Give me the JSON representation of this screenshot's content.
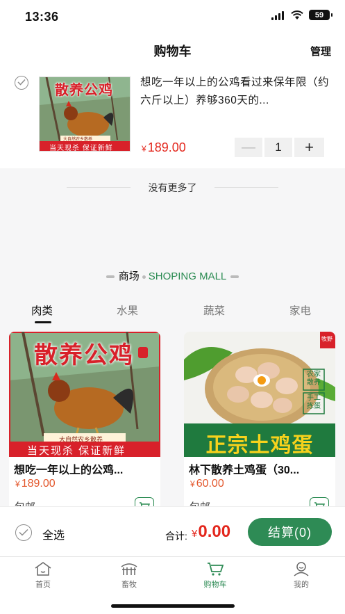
{
  "status_bar": {
    "time": "13:36",
    "battery": "59"
  },
  "nav": {
    "title": "购物车",
    "manage": "管理"
  },
  "cart": {
    "item": {
      "title": "想吃一年以上的公鸡看过来保年限（约六斤以上）养够360天的...",
      "currency": "¥",
      "price": "189.00",
      "quantity": "1",
      "minus": "—",
      "plus": "+",
      "image_banner": "散养公鸡",
      "image_sub": "大自然农乡散养",
      "image_footer": "当天现杀 保证新鲜"
    },
    "no_more": "没有更多了"
  },
  "mall": {
    "title_cn": "商场",
    "title_en": "SHOPING MALL",
    "tabs": [
      "肉类",
      "水果",
      "蔬菜",
      "家电"
    ],
    "active_tab": 0,
    "products": [
      {
        "name": "想吃一年以上的公鸡...",
        "currency": "¥",
        "price": "189.00",
        "shipping": "包邮",
        "image_banner": "散养公鸡",
        "image_sub": "大自然农乡散养",
        "image_footer": "当天现杀 保证新鲜"
      },
      {
        "name": "林下散养土鸡蛋（30...",
        "currency": "¥",
        "price": "60.00",
        "shipping": "包邮",
        "image_banner": "正宗土鸡蛋",
        "image_badge": "牧野",
        "image_tag1": "农家散养",
        "image_tag2": "手工拣蛋"
      }
    ]
  },
  "checkout": {
    "select_all": "全选",
    "total_label": "合计:",
    "currency": "¥",
    "total": "0.00",
    "button": "结算(0)"
  },
  "tab_bar": {
    "items": [
      {
        "label": "首页",
        "icon": "home-icon"
      },
      {
        "label": "畜牧",
        "icon": "farm-icon"
      },
      {
        "label": "购物车",
        "icon": "cart-icon"
      },
      {
        "label": "我的",
        "icon": "profile-icon"
      }
    ],
    "active": 2
  },
  "colors": {
    "accent": "#2e8b55",
    "price": "#e3261c"
  }
}
